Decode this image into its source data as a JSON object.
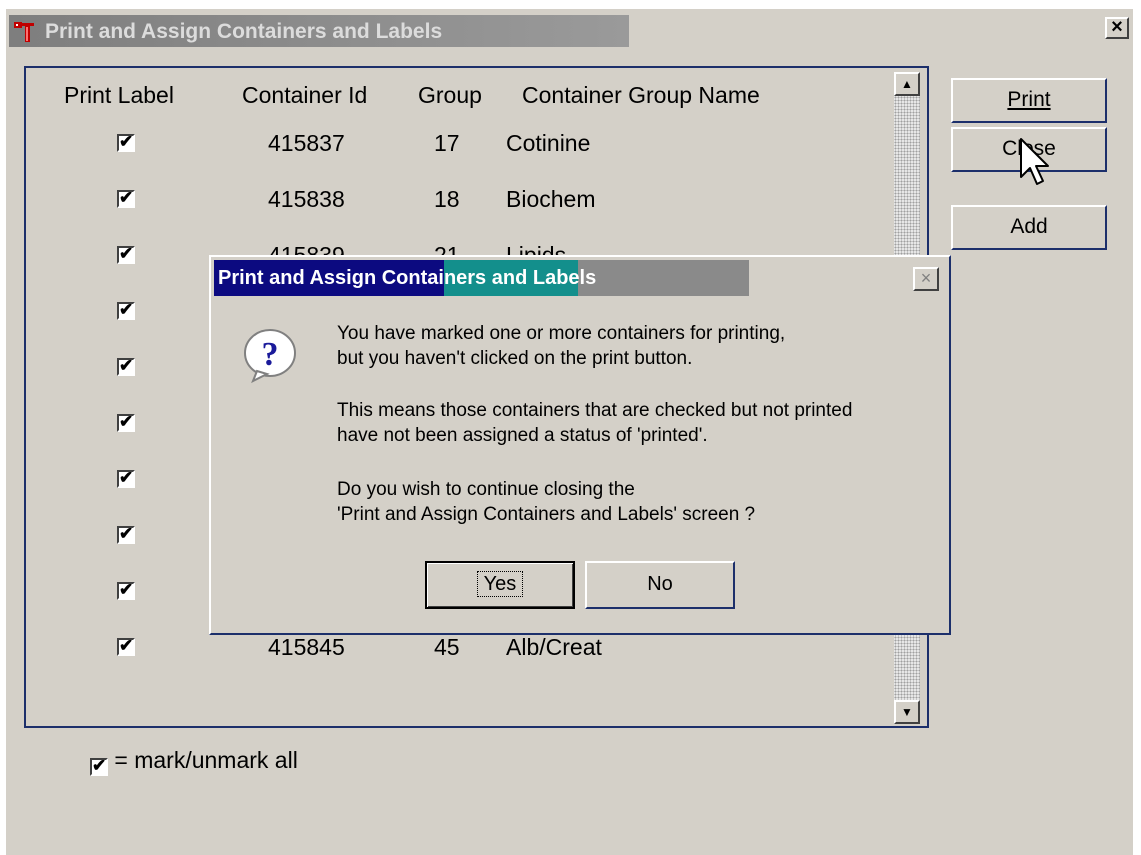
{
  "window": {
    "title": "Print and Assign Containers and Labels",
    "close_label": "×"
  },
  "grid": {
    "headers": {
      "print_label": "Print Label",
      "container_id": "Container Id",
      "group": "Group",
      "group_name": "Container Group Name"
    },
    "rows": [
      {
        "checked": true,
        "container_id": "415837",
        "group": "17",
        "group_name": "Cotinine"
      },
      {
        "checked": true,
        "container_id": "415838",
        "group": "18",
        "group_name": "Biochem"
      },
      {
        "checked": true,
        "container_id": "415839",
        "group": "21",
        "group_name": "Lipids"
      },
      {
        "checked": true,
        "container_id": "",
        "group": "",
        "group_name": ""
      },
      {
        "checked": true,
        "container_id": "",
        "group": "",
        "group_name": ""
      },
      {
        "checked": true,
        "container_id": "",
        "group": "",
        "group_name": ""
      },
      {
        "checked": true,
        "container_id": "",
        "group": "",
        "group_name": ""
      },
      {
        "checked": true,
        "container_id": "",
        "group": "",
        "group_name": ""
      },
      {
        "checked": true,
        "container_id": "",
        "group": "",
        "group_name": ""
      },
      {
        "checked": true,
        "container_id": "415845",
        "group": "45",
        "group_name": "Alb/Creat"
      }
    ],
    "check_glyph": "✔"
  },
  "buttons": {
    "print": "Print",
    "close": "Close",
    "add": "Add"
  },
  "mark_all": {
    "label": "= mark/unmark all",
    "checked": true
  },
  "dialog": {
    "title": "Print and Assign Containers and Labels",
    "close_label": "×",
    "icon": "question-icon",
    "lines": [
      "You have marked one or more containers for printing,",
      "but you haven't clicked on the print button.",
      "This means those containers that are checked but not printed",
      "have not been assigned a status of 'printed'.",
      "Do you wish to continue closing the",
      "'Print and Assign Containers and Labels' screen ?"
    ],
    "yes": "Yes",
    "no": "No"
  }
}
